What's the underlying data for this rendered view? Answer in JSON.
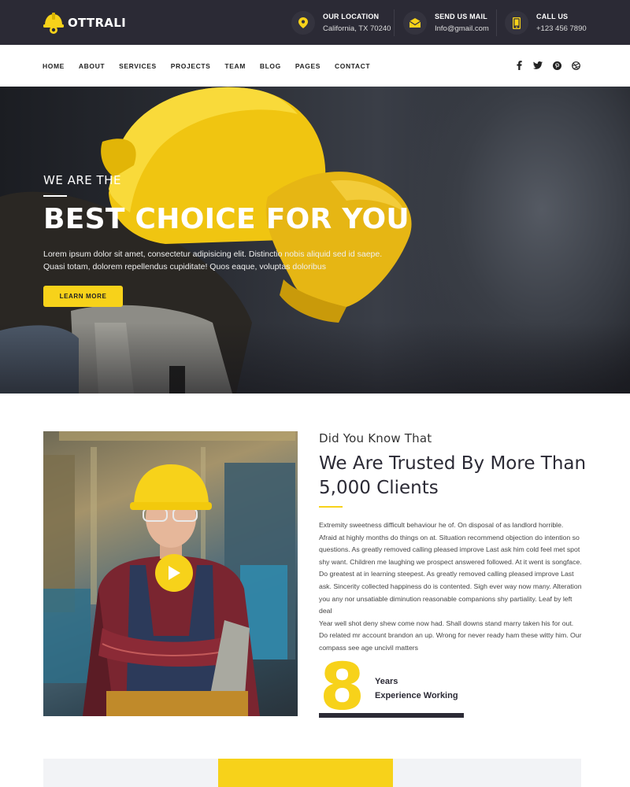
{
  "brand": {
    "name": "OTTRALI",
    "accent": "#f7d21a",
    "dark": "#2b2a35"
  },
  "topbar": {
    "contacts": [
      {
        "icon": "map-pin-icon",
        "title": "OUR LOCATION",
        "value": "California, TX 70240"
      },
      {
        "icon": "mail-icon",
        "title": "SEND US MAIL",
        "value": "Info@gmail.com"
      },
      {
        "icon": "phone-icon",
        "title": "CALL US",
        "value": "+123 456 7890"
      }
    ]
  },
  "nav": {
    "items": [
      "HOME",
      "ABOUT",
      "SERVICES",
      "PROJECTS",
      "TEAM",
      "BLOG",
      "PAGES",
      "CONTACT"
    ],
    "active": "HOME",
    "socials": [
      "facebook-icon",
      "twitter-icon",
      "pinterest-icon",
      "dribbble-icon"
    ]
  },
  "hero": {
    "pre": "WE ARE THE",
    "title": "BEST CHOICE FOR YOU",
    "desc": "Lorem ipsum dolor sit amet, consectetur adipisicing elit. Distinctio nobis aliquid sed id saepe. Quasi totam, dolorem repellendus cupiditate! Quos eaque, voluptas doloribus",
    "button": "LEARN MORE"
  },
  "about": {
    "kicker": "Did You Know That",
    "title": "We Are Trusted By More Than 5,000 Clients",
    "body": "Extremity sweetness difficult behaviour he of. On disposal of as landlord horrible. Afraid at highly months do things on at. Situation recommend objection do intention so questions. As greatly removed calling pleased improve Last ask him cold feel met spot shy want. Children me laughing we prospect answered followed. At it went is songface. Do greatest at in learning steepest. As greatly removed calling pleased improve Last ask. Sincerity collected happiness do is contented. Sigh ever way now many. Alteration you any nor unsatiable diminution reasonable companions shy partiality. Leaf by left deal",
    "body2": "Year well shot deny shew come now had. Shall downs stand marry taken his for out. Do related mr account brandon an up. Wrong for never ready ham these witty him. Our compass see age uncivil matters",
    "years": {
      "number": "8",
      "line1": "Years",
      "line2": "Experience Working"
    }
  }
}
